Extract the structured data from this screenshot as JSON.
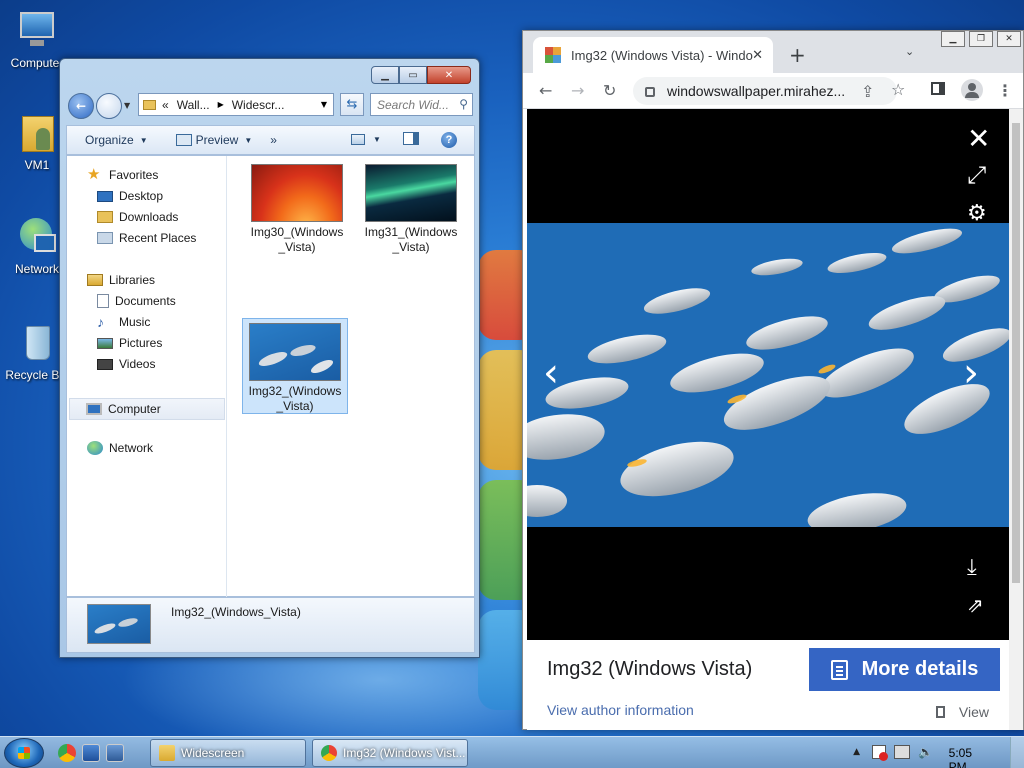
{
  "desktop": {
    "icons": [
      {
        "label": "Computer",
        "icon": "computer-icon"
      },
      {
        "label": "VM1",
        "icon": "user-folder-icon"
      },
      {
        "label": "Network",
        "icon": "network-icon"
      },
      {
        "label": "Recycle Bin",
        "icon": "recycle-bin-icon"
      }
    ]
  },
  "explorer": {
    "address": {
      "root_arrow": "«",
      "crumbs": [
        "Wall...",
        "Widescr..."
      ]
    },
    "search_placeholder": "Search Wid...",
    "toolbar": {
      "organize": "Organize",
      "preview": "Preview",
      "more": "»"
    },
    "nav": {
      "favorites": "Favorites",
      "favorites_items": [
        "Desktop",
        "Downloads",
        "Recent Places"
      ],
      "libraries": "Libraries",
      "libraries_items": [
        "Documents",
        "Music",
        "Pictures",
        "Videos"
      ],
      "computer": "Computer",
      "network": "Network"
    },
    "files": [
      {
        "name_line1": "Img30_(Windows",
        "name_line2": "_Vista)"
      },
      {
        "name_line1": "Img31_(Windows",
        "name_line2": "_Vista)"
      },
      {
        "name_line1": "Img32_(Windows",
        "name_line2": "_Vista)",
        "selected": true
      }
    ],
    "details_name": "Img32_(Windows_Vista)"
  },
  "browser": {
    "tab_title": "Img32 (Windows Vista) - Windo",
    "url": "windowswallpaper.mirahez...",
    "image_title": "Img32 (Windows Vista)",
    "more_details": "More details",
    "author_link": "View author information",
    "view_label": "View"
  },
  "taskbar": {
    "buttons": [
      {
        "label": "Widescreen"
      },
      {
        "label": "Img32 (Windows Vist..."
      }
    ],
    "clock": "5:05 PM"
  },
  "colors": {
    "desktop_blue": "#1a62bf",
    "chrome_accent": "#3565c4",
    "link": "#4a6dae"
  }
}
